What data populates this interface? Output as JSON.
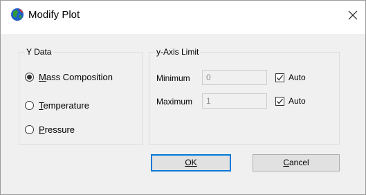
{
  "window": {
    "title": "Modify Plot"
  },
  "y_data": {
    "legend": "Y Data",
    "options": [
      {
        "label": "Mass Composition",
        "checked": true
      },
      {
        "label": "Temperature",
        "checked": false
      },
      {
        "label": "Pressure",
        "checked": false
      }
    ]
  },
  "y_axis_limit": {
    "legend": "y-Axis Limit",
    "minimum": {
      "label": "Minimum",
      "value": "0",
      "auto_label": "Auto",
      "auto_checked": true
    },
    "maximum": {
      "label": "Maximum",
      "value": "1",
      "auto_label": "Auto",
      "auto_checked": true
    }
  },
  "buttons": {
    "ok_label": "OK",
    "cancel_label": "Cancel"
  },
  "icons": {
    "app": "globe-icon",
    "close": "close-icon",
    "check": "check-icon"
  },
  "colors": {
    "default_button_border": "#0078d7",
    "globe_land": "#2e9a3a",
    "globe_sea": "#1f5fc8",
    "globe_highlight": "#d32f2f"
  }
}
